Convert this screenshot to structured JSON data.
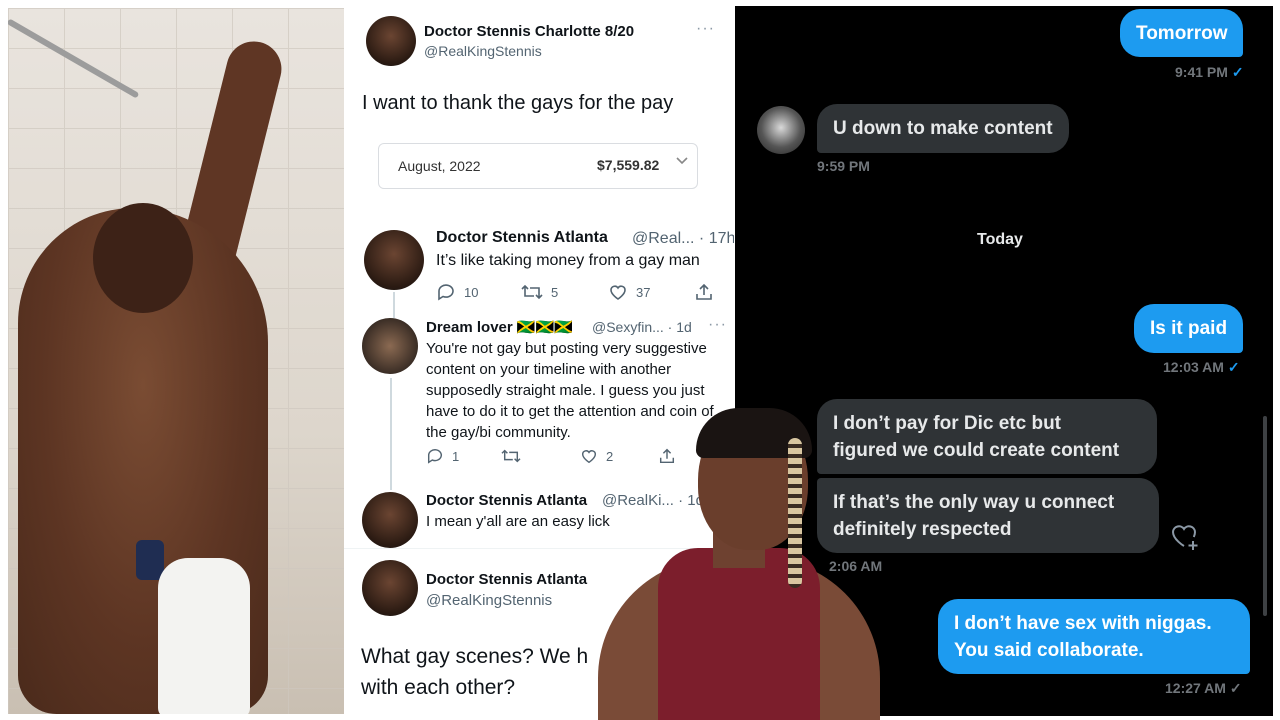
{
  "tweet_top": {
    "name": "Doctor Stennis Charlotte 8/20",
    "handle": "@RealKingStennis",
    "text": "I want to thank the gays for the pay",
    "payout": {
      "month": "August, 2022",
      "amount": "$7,559.82"
    }
  },
  "tweet_atlanta": {
    "name": "Doctor Stennis Atlanta",
    "handle_time": "@Real... · 17h",
    "text": "It’s like taking money from a gay man",
    "replies": "10",
    "retweets": "5",
    "likes": "37"
  },
  "tweet_reply": {
    "name": "Dream lover 🇯🇲🇯🇲🇯🇲",
    "handle_time": "@Sexyfin... · 1d",
    "text": "You're not gay but posting very suggestive content on your timeline with another supposedly straight male. I guess you just have to do it to get the attention and coin of the gay/bi community.",
    "replies": "1",
    "retweets": "",
    "likes": "2"
  },
  "tweet_atlanta2": {
    "name": "Doctor Stennis Atlanta",
    "handle_time": "@RealKi... · 1d",
    "text": "I mean y'all are an easy lick"
  },
  "tweet_bottom": {
    "name": "Doctor Stennis Atlanta",
    "handle": "@RealKingStennis",
    "text_line1": "What gay scenes? We h",
    "text_line2": "with each other?"
  },
  "dm": {
    "msg1": "Tomorrow",
    "msg1_time": "9:41 PM",
    "msg2": "U down to make content",
    "msg2_time": "9:59 PM",
    "day_separator": "Today",
    "msg3": "Is it paid",
    "msg3_time": "12:03 AM",
    "msg4_line1": "I don’t pay for Dic etc but",
    "msg4_line2": "figured we could create content",
    "msg5_line1": "If that’s the only way u connect",
    "msg5_line2": "definitely respected",
    "msg5_time": "2:06 AM",
    "msg6_line1": "I don’t have sex with niggas.",
    "msg6_line2": "You said collaborate.",
    "msg6_time": "12:27 AM",
    "read_check": "✓"
  },
  "colors": {
    "twitter_blue": "#1d9bf0",
    "dm_incoming": "#2f3336",
    "dm_bg": "#000000"
  }
}
